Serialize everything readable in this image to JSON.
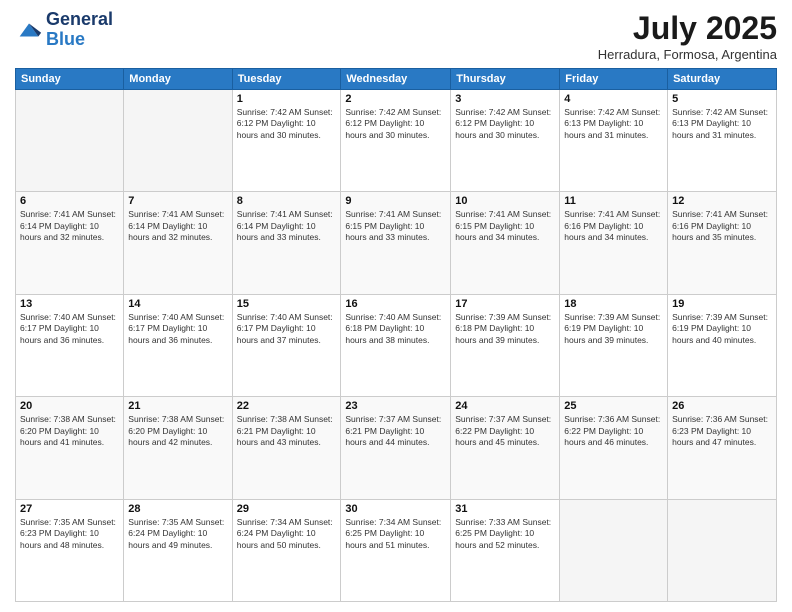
{
  "logo": {
    "line1": "General",
    "line2": "Blue"
  },
  "title": "July 2025",
  "location": "Herradura, Formosa, Argentina",
  "days_header": [
    "Sunday",
    "Monday",
    "Tuesday",
    "Wednesday",
    "Thursday",
    "Friday",
    "Saturday"
  ],
  "weeks": [
    [
      {
        "day": "",
        "info": ""
      },
      {
        "day": "",
        "info": ""
      },
      {
        "day": "1",
        "info": "Sunrise: 7:42 AM\nSunset: 6:12 PM\nDaylight: 10 hours\nand 30 minutes."
      },
      {
        "day": "2",
        "info": "Sunrise: 7:42 AM\nSunset: 6:12 PM\nDaylight: 10 hours\nand 30 minutes."
      },
      {
        "day": "3",
        "info": "Sunrise: 7:42 AM\nSunset: 6:12 PM\nDaylight: 10 hours\nand 30 minutes."
      },
      {
        "day": "4",
        "info": "Sunrise: 7:42 AM\nSunset: 6:13 PM\nDaylight: 10 hours\nand 31 minutes."
      },
      {
        "day": "5",
        "info": "Sunrise: 7:42 AM\nSunset: 6:13 PM\nDaylight: 10 hours\nand 31 minutes."
      }
    ],
    [
      {
        "day": "6",
        "info": "Sunrise: 7:41 AM\nSunset: 6:14 PM\nDaylight: 10 hours\nand 32 minutes."
      },
      {
        "day": "7",
        "info": "Sunrise: 7:41 AM\nSunset: 6:14 PM\nDaylight: 10 hours\nand 32 minutes."
      },
      {
        "day": "8",
        "info": "Sunrise: 7:41 AM\nSunset: 6:14 PM\nDaylight: 10 hours\nand 33 minutes."
      },
      {
        "day": "9",
        "info": "Sunrise: 7:41 AM\nSunset: 6:15 PM\nDaylight: 10 hours\nand 33 minutes."
      },
      {
        "day": "10",
        "info": "Sunrise: 7:41 AM\nSunset: 6:15 PM\nDaylight: 10 hours\nand 34 minutes."
      },
      {
        "day": "11",
        "info": "Sunrise: 7:41 AM\nSunset: 6:16 PM\nDaylight: 10 hours\nand 34 minutes."
      },
      {
        "day": "12",
        "info": "Sunrise: 7:41 AM\nSunset: 6:16 PM\nDaylight: 10 hours\nand 35 minutes."
      }
    ],
    [
      {
        "day": "13",
        "info": "Sunrise: 7:40 AM\nSunset: 6:17 PM\nDaylight: 10 hours\nand 36 minutes."
      },
      {
        "day": "14",
        "info": "Sunrise: 7:40 AM\nSunset: 6:17 PM\nDaylight: 10 hours\nand 36 minutes."
      },
      {
        "day": "15",
        "info": "Sunrise: 7:40 AM\nSunset: 6:17 PM\nDaylight: 10 hours\nand 37 minutes."
      },
      {
        "day": "16",
        "info": "Sunrise: 7:40 AM\nSunset: 6:18 PM\nDaylight: 10 hours\nand 38 minutes."
      },
      {
        "day": "17",
        "info": "Sunrise: 7:39 AM\nSunset: 6:18 PM\nDaylight: 10 hours\nand 39 minutes."
      },
      {
        "day": "18",
        "info": "Sunrise: 7:39 AM\nSunset: 6:19 PM\nDaylight: 10 hours\nand 39 minutes."
      },
      {
        "day": "19",
        "info": "Sunrise: 7:39 AM\nSunset: 6:19 PM\nDaylight: 10 hours\nand 40 minutes."
      }
    ],
    [
      {
        "day": "20",
        "info": "Sunrise: 7:38 AM\nSunset: 6:20 PM\nDaylight: 10 hours\nand 41 minutes."
      },
      {
        "day": "21",
        "info": "Sunrise: 7:38 AM\nSunset: 6:20 PM\nDaylight: 10 hours\nand 42 minutes."
      },
      {
        "day": "22",
        "info": "Sunrise: 7:38 AM\nSunset: 6:21 PM\nDaylight: 10 hours\nand 43 minutes."
      },
      {
        "day": "23",
        "info": "Sunrise: 7:37 AM\nSunset: 6:21 PM\nDaylight: 10 hours\nand 44 minutes."
      },
      {
        "day": "24",
        "info": "Sunrise: 7:37 AM\nSunset: 6:22 PM\nDaylight: 10 hours\nand 45 minutes."
      },
      {
        "day": "25",
        "info": "Sunrise: 7:36 AM\nSunset: 6:22 PM\nDaylight: 10 hours\nand 46 minutes."
      },
      {
        "day": "26",
        "info": "Sunrise: 7:36 AM\nSunset: 6:23 PM\nDaylight: 10 hours\nand 47 minutes."
      }
    ],
    [
      {
        "day": "27",
        "info": "Sunrise: 7:35 AM\nSunset: 6:23 PM\nDaylight: 10 hours\nand 48 minutes."
      },
      {
        "day": "28",
        "info": "Sunrise: 7:35 AM\nSunset: 6:24 PM\nDaylight: 10 hours\nand 49 minutes."
      },
      {
        "day": "29",
        "info": "Sunrise: 7:34 AM\nSunset: 6:24 PM\nDaylight: 10 hours\nand 50 minutes."
      },
      {
        "day": "30",
        "info": "Sunrise: 7:34 AM\nSunset: 6:25 PM\nDaylight: 10 hours\nand 51 minutes."
      },
      {
        "day": "31",
        "info": "Sunrise: 7:33 AM\nSunset: 6:25 PM\nDaylight: 10 hours\nand 52 minutes."
      },
      {
        "day": "",
        "info": ""
      },
      {
        "day": "",
        "info": ""
      }
    ]
  ]
}
